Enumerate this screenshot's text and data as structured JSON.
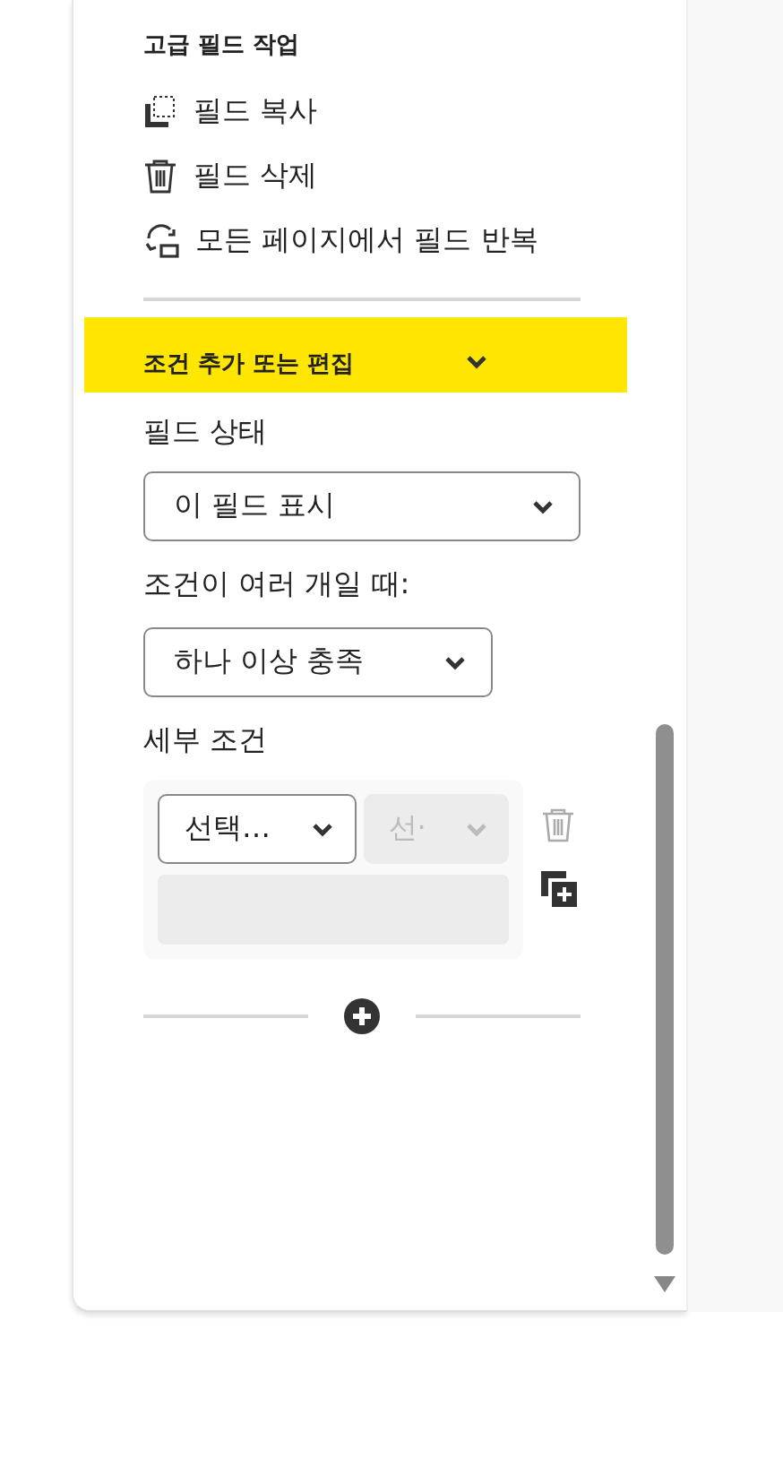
{
  "section_title": "고급 필드 작업",
  "actions": [
    {
      "kind": "copy",
      "label": "필드 복사"
    },
    {
      "kind": "delete",
      "label": "필드 삭제"
    },
    {
      "kind": "repeat",
      "label": "모든 페이지에서 필드 반복"
    }
  ],
  "condition_header": {
    "label": "조건 추가 또는 편집",
    "expanded": true
  },
  "field_state": {
    "label": "필드 상태",
    "value": "이 필드 표시"
  },
  "multi": {
    "label": "조건이 여러 개일 때:",
    "value": "하나 이상 충족"
  },
  "details": {
    "label": "세부 조건",
    "condition": {
      "field": "선택…",
      "operator": "선·",
      "operator_disabled": true
    }
  }
}
